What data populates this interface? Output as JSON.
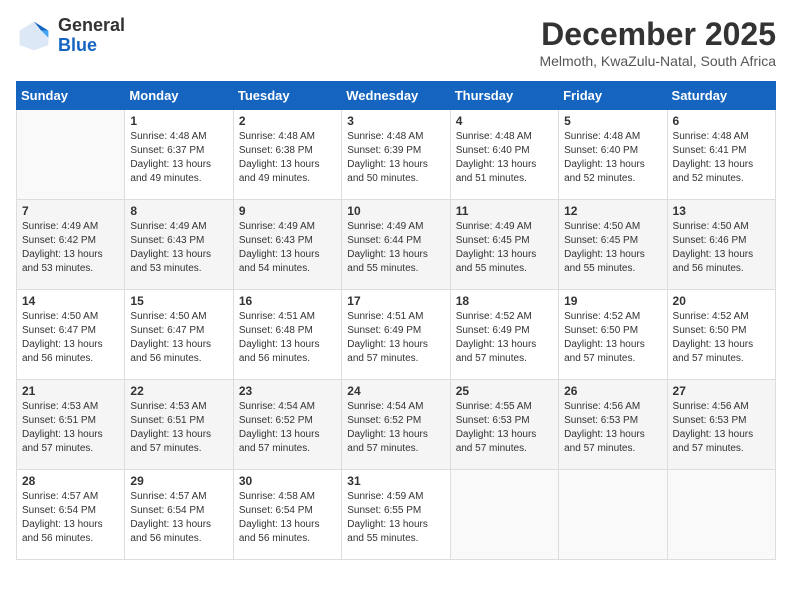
{
  "header": {
    "logo": {
      "general": "General",
      "blue": "Blue"
    },
    "title": "December 2025",
    "location": "Melmoth, KwaZulu-Natal, South Africa"
  },
  "weekdays": [
    "Sunday",
    "Monday",
    "Tuesday",
    "Wednesday",
    "Thursday",
    "Friday",
    "Saturday"
  ],
  "weeks": [
    [
      {
        "day": "",
        "sunrise": "",
        "sunset": "",
        "daylight": ""
      },
      {
        "day": "1",
        "sunrise": "Sunrise: 4:48 AM",
        "sunset": "Sunset: 6:37 PM",
        "daylight": "Daylight: 13 hours and 49 minutes."
      },
      {
        "day": "2",
        "sunrise": "Sunrise: 4:48 AM",
        "sunset": "Sunset: 6:38 PM",
        "daylight": "Daylight: 13 hours and 49 minutes."
      },
      {
        "day": "3",
        "sunrise": "Sunrise: 4:48 AM",
        "sunset": "Sunset: 6:39 PM",
        "daylight": "Daylight: 13 hours and 50 minutes."
      },
      {
        "day": "4",
        "sunrise": "Sunrise: 4:48 AM",
        "sunset": "Sunset: 6:40 PM",
        "daylight": "Daylight: 13 hours and 51 minutes."
      },
      {
        "day": "5",
        "sunrise": "Sunrise: 4:48 AM",
        "sunset": "Sunset: 6:40 PM",
        "daylight": "Daylight: 13 hours and 52 minutes."
      },
      {
        "day": "6",
        "sunrise": "Sunrise: 4:48 AM",
        "sunset": "Sunset: 6:41 PM",
        "daylight": "Daylight: 13 hours and 52 minutes."
      }
    ],
    [
      {
        "day": "7",
        "sunrise": "Sunrise: 4:49 AM",
        "sunset": "Sunset: 6:42 PM",
        "daylight": "Daylight: 13 hours and 53 minutes."
      },
      {
        "day": "8",
        "sunrise": "Sunrise: 4:49 AM",
        "sunset": "Sunset: 6:43 PM",
        "daylight": "Daylight: 13 hours and 53 minutes."
      },
      {
        "day": "9",
        "sunrise": "Sunrise: 4:49 AM",
        "sunset": "Sunset: 6:43 PM",
        "daylight": "Daylight: 13 hours and 54 minutes."
      },
      {
        "day": "10",
        "sunrise": "Sunrise: 4:49 AM",
        "sunset": "Sunset: 6:44 PM",
        "daylight": "Daylight: 13 hours and 55 minutes."
      },
      {
        "day": "11",
        "sunrise": "Sunrise: 4:49 AM",
        "sunset": "Sunset: 6:45 PM",
        "daylight": "Daylight: 13 hours and 55 minutes."
      },
      {
        "day": "12",
        "sunrise": "Sunrise: 4:50 AM",
        "sunset": "Sunset: 6:45 PM",
        "daylight": "Daylight: 13 hours and 55 minutes."
      },
      {
        "day": "13",
        "sunrise": "Sunrise: 4:50 AM",
        "sunset": "Sunset: 6:46 PM",
        "daylight": "Daylight: 13 hours and 56 minutes."
      }
    ],
    [
      {
        "day": "14",
        "sunrise": "Sunrise: 4:50 AM",
        "sunset": "Sunset: 6:47 PM",
        "daylight": "Daylight: 13 hours and 56 minutes."
      },
      {
        "day": "15",
        "sunrise": "Sunrise: 4:50 AM",
        "sunset": "Sunset: 6:47 PM",
        "daylight": "Daylight: 13 hours and 56 minutes."
      },
      {
        "day": "16",
        "sunrise": "Sunrise: 4:51 AM",
        "sunset": "Sunset: 6:48 PM",
        "daylight": "Daylight: 13 hours and 56 minutes."
      },
      {
        "day": "17",
        "sunrise": "Sunrise: 4:51 AM",
        "sunset": "Sunset: 6:49 PM",
        "daylight": "Daylight: 13 hours and 57 minutes."
      },
      {
        "day": "18",
        "sunrise": "Sunrise: 4:52 AM",
        "sunset": "Sunset: 6:49 PM",
        "daylight": "Daylight: 13 hours and 57 minutes."
      },
      {
        "day": "19",
        "sunrise": "Sunrise: 4:52 AM",
        "sunset": "Sunset: 6:50 PM",
        "daylight": "Daylight: 13 hours and 57 minutes."
      },
      {
        "day": "20",
        "sunrise": "Sunrise: 4:52 AM",
        "sunset": "Sunset: 6:50 PM",
        "daylight": "Daylight: 13 hours and 57 minutes."
      }
    ],
    [
      {
        "day": "21",
        "sunrise": "Sunrise: 4:53 AM",
        "sunset": "Sunset: 6:51 PM",
        "daylight": "Daylight: 13 hours and 57 minutes."
      },
      {
        "day": "22",
        "sunrise": "Sunrise: 4:53 AM",
        "sunset": "Sunset: 6:51 PM",
        "daylight": "Daylight: 13 hours and 57 minutes."
      },
      {
        "day": "23",
        "sunrise": "Sunrise: 4:54 AM",
        "sunset": "Sunset: 6:52 PM",
        "daylight": "Daylight: 13 hours and 57 minutes."
      },
      {
        "day": "24",
        "sunrise": "Sunrise: 4:54 AM",
        "sunset": "Sunset: 6:52 PM",
        "daylight": "Daylight: 13 hours and 57 minutes."
      },
      {
        "day": "25",
        "sunrise": "Sunrise: 4:55 AM",
        "sunset": "Sunset: 6:53 PM",
        "daylight": "Daylight: 13 hours and 57 minutes."
      },
      {
        "day": "26",
        "sunrise": "Sunrise: 4:56 AM",
        "sunset": "Sunset: 6:53 PM",
        "daylight": "Daylight: 13 hours and 57 minutes."
      },
      {
        "day": "27",
        "sunrise": "Sunrise: 4:56 AM",
        "sunset": "Sunset: 6:53 PM",
        "daylight": "Daylight: 13 hours and 57 minutes."
      }
    ],
    [
      {
        "day": "28",
        "sunrise": "Sunrise: 4:57 AM",
        "sunset": "Sunset: 6:54 PM",
        "daylight": "Daylight: 13 hours and 56 minutes."
      },
      {
        "day": "29",
        "sunrise": "Sunrise: 4:57 AM",
        "sunset": "Sunset: 6:54 PM",
        "daylight": "Daylight: 13 hours and 56 minutes."
      },
      {
        "day": "30",
        "sunrise": "Sunrise: 4:58 AM",
        "sunset": "Sunset: 6:54 PM",
        "daylight": "Daylight: 13 hours and 56 minutes."
      },
      {
        "day": "31",
        "sunrise": "Sunrise: 4:59 AM",
        "sunset": "Sunset: 6:55 PM",
        "daylight": "Daylight: 13 hours and 55 minutes."
      },
      {
        "day": "",
        "sunrise": "",
        "sunset": "",
        "daylight": ""
      },
      {
        "day": "",
        "sunrise": "",
        "sunset": "",
        "daylight": ""
      },
      {
        "day": "",
        "sunrise": "",
        "sunset": "",
        "daylight": ""
      }
    ]
  ]
}
